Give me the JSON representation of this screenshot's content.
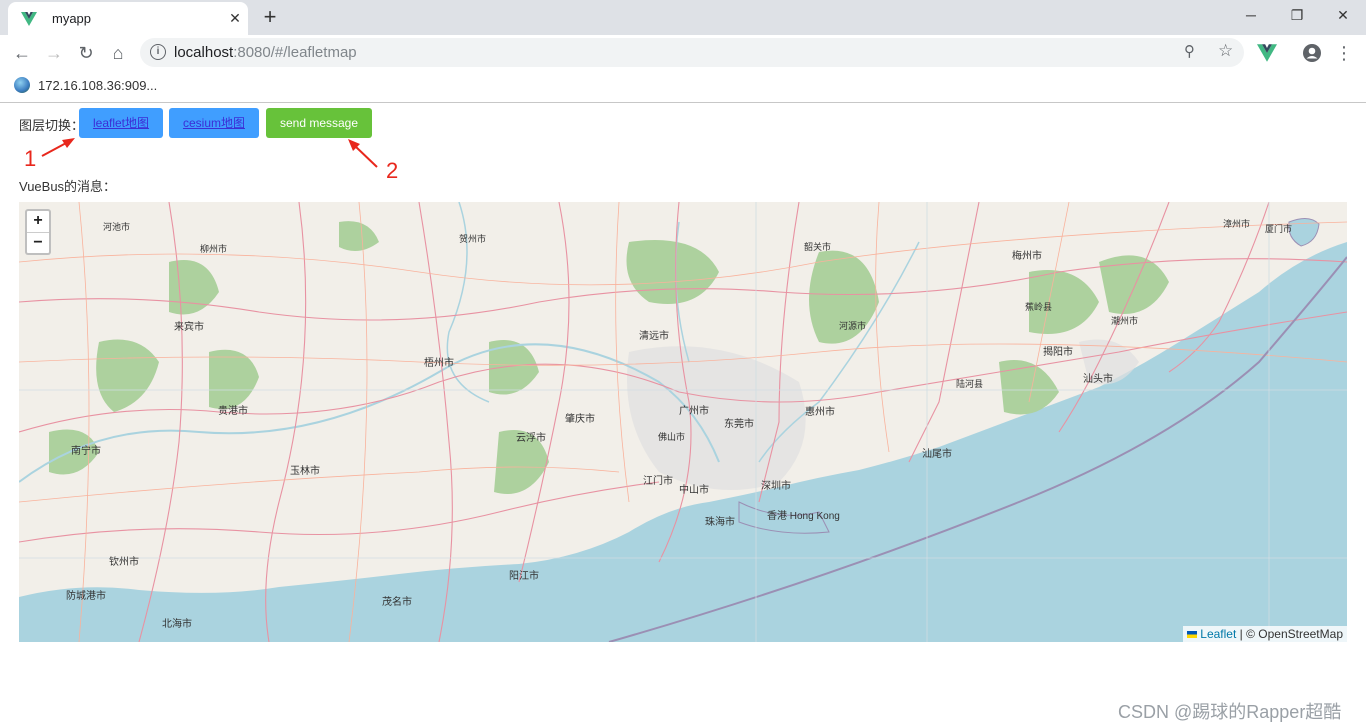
{
  "browser": {
    "tab_title": "myapp",
    "tab_close": "✕",
    "new_tab": "+",
    "window_controls": {
      "minimize": "─",
      "restore": "❐",
      "close": "✕"
    },
    "nav": {
      "back": "←",
      "forward": "→",
      "reload": "↻",
      "home": "⌂"
    },
    "url_host": "localhost",
    "url_rest": ":8080/#/leafletmap",
    "info_icon": "i",
    "zoom_icon": "⚲",
    "star_icon": "☆",
    "menu_icon": "⋮",
    "bookmark_label": "172.16.108.36:909..."
  },
  "page": {
    "layer_switch_label": "图层切换：",
    "leaflet_button": "leaflet地图",
    "cesium_button": "cesium地图",
    "send_button": "send message",
    "vuebus_label": "VueBus的消息："
  },
  "annotations": {
    "one": "1",
    "two": "2"
  },
  "map": {
    "zoom_in": "+",
    "zoom_out": "−",
    "attribution_leaflet": "Leaflet",
    "attribution_rest": " | © OpenStreetMap",
    "cities": {
      "hechi": "河池市",
      "liuzhou": "柳州市",
      "hezhou": "贺州市",
      "shaoguan": "韶关市",
      "heyuan": "河源市",
      "meizhou": "梅州市",
      "zhangzhou": "漳州市",
      "xiamen": "厦门市",
      "laibin": "来宾市",
      "wuzhou": "梧州市",
      "qingyuan": "清远市",
      "guangzhou": "广州市",
      "huizhou": "惠州市",
      "dongguan": "东莞市",
      "zhaoqing": "肇庆市",
      "yunfu": "云浮市",
      "guigang": "贵港市",
      "nanning": "南宁市",
      "yulin": "玉林市",
      "jiangmen": "江门市",
      "zhongshan": "中山市",
      "shenzhen": "深圳市",
      "zhuhai": "珠海市",
      "hongkong": "香港 Hong Kong",
      "yangjiang": "阳江市",
      "maoming": "茂名市",
      "qinzhou": "钦州市",
      "fangchenggang": "防城港市",
      "beihai": "北海市",
      "shanwei": "汕尾市",
      "shantou": "汕头市",
      "jieyang": "揭阳市",
      "chaozhou": "潮州市",
      "foshan": "佛山市",
      "jiaoling": "蕉岭县",
      "luhe": "陆河县"
    }
  },
  "watermark": "CSDN @踢球的Rapper超酷",
  "colors": {
    "primary": "#409eff",
    "success": "#67c23a",
    "annotation": "#e8271c",
    "sea": "#aad3df",
    "land": "#f2efe9",
    "forest": "#add19e"
  }
}
